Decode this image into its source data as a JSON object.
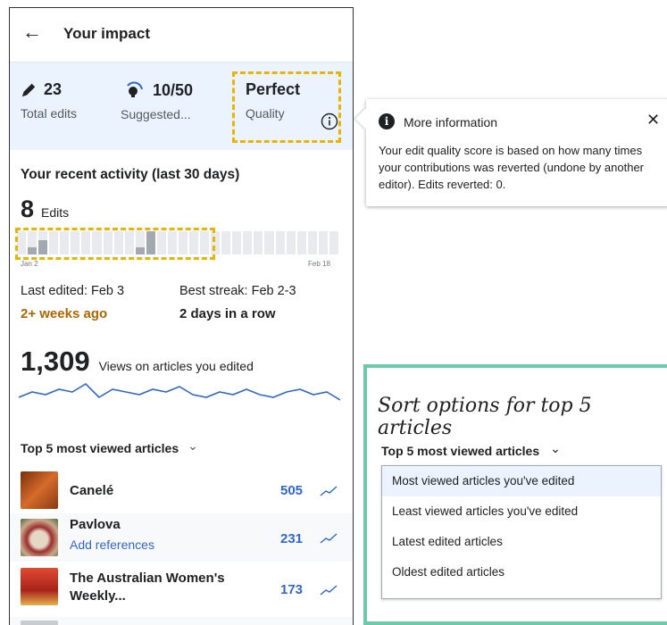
{
  "header": {
    "back_icon": "←",
    "title": "Your impact"
  },
  "stats": [
    {
      "value": "23",
      "label": "Total edits",
      "icon": "pencil-icon"
    },
    {
      "value": "10/50",
      "label": "Suggested...",
      "icon": "lightbulb-icon"
    },
    {
      "value": "Perfect",
      "label": "Quality",
      "icon": "info-icon"
    }
  ],
  "activity": {
    "title": "Your recent activity (last 30 days)",
    "edits_count": "8",
    "edits_label": "Edits",
    "start_date": "Jan 2",
    "end_date": "Feb 18",
    "bar_levels": [
      0.0,
      0.3,
      0.6,
      0,
      0,
      0,
      0,
      0,
      0,
      0,
      0,
      0.3,
      1.0,
      0,
      0,
      0,
      0,
      0,
      0,
      0,
      0,
      0,
      0,
      0,
      0,
      0,
      0,
      0,
      0,
      0
    ]
  },
  "last_edited": {
    "label": "Last edited: Feb 3",
    "value": "2+ weeks ago",
    "value_color": "#ac6600"
  },
  "best_streak": {
    "label": "Best streak: Feb 2-3",
    "value": "2 days in a row"
  },
  "views": {
    "count": "1,309",
    "label": "Views on articles you edited",
    "line_color": "#3366cc",
    "sparkline": [
      3,
      5,
      4,
      6,
      5,
      8,
      3,
      6,
      5,
      4,
      6,
      5,
      7,
      4,
      3,
      5,
      4,
      6,
      4,
      3,
      5,
      6,
      4,
      5,
      2
    ]
  },
  "top_articles": {
    "heading": "Top 5 most viewed articles",
    "chevron": "⌄",
    "items": [
      {
        "title": "Canelé",
        "subtitle": "",
        "views": "505",
        "thumb_color": "#b5561d"
      },
      {
        "title": "Pavlova",
        "subtitle": "Add references",
        "views": "231",
        "thumb_color": "#c9a88b"
      },
      {
        "title": "The Australian Women's Weekly...",
        "subtitle": "",
        "views": "173",
        "thumb_color": "#c0392b"
      }
    ]
  },
  "popover": {
    "icon": "i",
    "title": "More information",
    "close": "✕",
    "body": "Your edit quality score is based on how many times your contributions was reverted (undone by another editor). Edits reverted: 0."
  },
  "sort_panel": {
    "title": "Sort options for top 5 articles",
    "dropdown_label": "Top 5 most viewed articles",
    "chevron": "⌄",
    "options": [
      "Most viewed articles you've edited",
      "Least viewed articles you've edited",
      "Latest edited articles",
      "Oldest edited articles"
    ],
    "selected_index": 0
  },
  "colors": {
    "highlight_dash": "#e8b400",
    "sort_border": "#6cc9a9",
    "link": "#3366cc"
  }
}
